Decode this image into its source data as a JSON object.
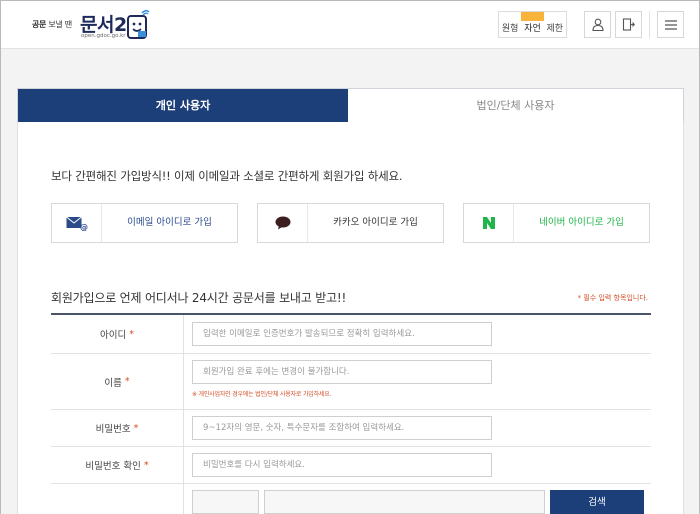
{
  "header": {
    "logo_small_bold": "공문",
    "logo_small_rest": " 보낼 땐",
    "logo_main": "문서24",
    "logo_url": "open.gdoc.go.kr",
    "font_sizes": [
      "원형",
      "자언",
      "제한"
    ],
    "active_font_size": 1,
    "login_icon": "user-icon",
    "signup_icon": "door-icon",
    "menu_icon": "hamburger-icon"
  },
  "tabs": [
    {
      "label": "개인 사용자",
      "active": true
    },
    {
      "label": "법인/단체 사용자",
      "active": false
    }
  ],
  "intro": "보다 간편해진 가입방식!! 이제 이메일과 소셜로 간편하게 회원가입 하세요.",
  "sns_buttons": [
    {
      "label": "이메일 아이디로 가입",
      "icon": "email-icon",
      "color": "#2a4a8c"
    },
    {
      "label": "카카오 아이디로 가입",
      "icon": "kakao-icon",
      "color": "#333333"
    },
    {
      "label": "네이버 아이디로 가입",
      "icon": "naver-icon",
      "color": "#1fb54a"
    }
  ],
  "section_title": "회원가입으로 언제 어디서나 24시간 공문서를 보내고 받고!!",
  "required_note": "* 필수 입력 항목입니다.",
  "form": {
    "id_label": "아이디",
    "id_placeholder": "입력한 이메일로 인증번호가 발송되므로 정확히 입력하세요.",
    "name_label": "이름",
    "name_placeholder": "회원가입 완료 후에는 변경이 불가합니다.",
    "name_warning": "※ 개인사업자인 경우에는 법인/단체 사용자로 가입하세요.",
    "pw_label": "비밀번호",
    "pw_placeholder": "9~12자의 영문, 숫자, 특수문자를 조합하여 입력하세요.",
    "pw_confirm_label": "비밀번호 확인",
    "pw_confirm_placeholder": "비밀번호를 다시 입력하세요.",
    "required_mark": "*",
    "search_label": "검색"
  },
  "colors": {
    "primary": "#1c3e79",
    "accent": "#f7b33a",
    "required": "#d34e24",
    "naver": "#1fb54a"
  }
}
